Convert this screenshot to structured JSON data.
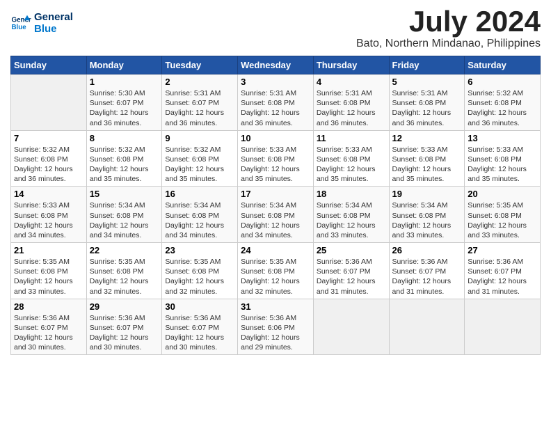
{
  "logo": {
    "line1": "General",
    "line2": "Blue"
  },
  "title": "July 2024",
  "location": "Bato, Northern Mindanao, Philippines",
  "days_of_week": [
    "Sunday",
    "Monday",
    "Tuesday",
    "Wednesday",
    "Thursday",
    "Friday",
    "Saturday"
  ],
  "weeks": [
    [
      {
        "day": "",
        "info": ""
      },
      {
        "day": "1",
        "info": "Sunrise: 5:30 AM\nSunset: 6:07 PM\nDaylight: 12 hours\nand 36 minutes."
      },
      {
        "day": "2",
        "info": "Sunrise: 5:31 AM\nSunset: 6:07 PM\nDaylight: 12 hours\nand 36 minutes."
      },
      {
        "day": "3",
        "info": "Sunrise: 5:31 AM\nSunset: 6:08 PM\nDaylight: 12 hours\nand 36 minutes."
      },
      {
        "day": "4",
        "info": "Sunrise: 5:31 AM\nSunset: 6:08 PM\nDaylight: 12 hours\nand 36 minutes."
      },
      {
        "day": "5",
        "info": "Sunrise: 5:31 AM\nSunset: 6:08 PM\nDaylight: 12 hours\nand 36 minutes."
      },
      {
        "day": "6",
        "info": "Sunrise: 5:32 AM\nSunset: 6:08 PM\nDaylight: 12 hours\nand 36 minutes."
      }
    ],
    [
      {
        "day": "7",
        "info": "Sunrise: 5:32 AM\nSunset: 6:08 PM\nDaylight: 12 hours\nand 36 minutes."
      },
      {
        "day": "8",
        "info": "Sunrise: 5:32 AM\nSunset: 6:08 PM\nDaylight: 12 hours\nand 35 minutes."
      },
      {
        "day": "9",
        "info": "Sunrise: 5:32 AM\nSunset: 6:08 PM\nDaylight: 12 hours\nand 35 minutes."
      },
      {
        "day": "10",
        "info": "Sunrise: 5:33 AM\nSunset: 6:08 PM\nDaylight: 12 hours\nand 35 minutes."
      },
      {
        "day": "11",
        "info": "Sunrise: 5:33 AM\nSunset: 6:08 PM\nDaylight: 12 hours\nand 35 minutes."
      },
      {
        "day": "12",
        "info": "Sunrise: 5:33 AM\nSunset: 6:08 PM\nDaylight: 12 hours\nand 35 minutes."
      },
      {
        "day": "13",
        "info": "Sunrise: 5:33 AM\nSunset: 6:08 PM\nDaylight: 12 hours\nand 35 minutes."
      }
    ],
    [
      {
        "day": "14",
        "info": "Sunrise: 5:33 AM\nSunset: 6:08 PM\nDaylight: 12 hours\nand 34 minutes."
      },
      {
        "day": "15",
        "info": "Sunrise: 5:34 AM\nSunset: 6:08 PM\nDaylight: 12 hours\nand 34 minutes."
      },
      {
        "day": "16",
        "info": "Sunrise: 5:34 AM\nSunset: 6:08 PM\nDaylight: 12 hours\nand 34 minutes."
      },
      {
        "day": "17",
        "info": "Sunrise: 5:34 AM\nSunset: 6:08 PM\nDaylight: 12 hours\nand 34 minutes."
      },
      {
        "day": "18",
        "info": "Sunrise: 5:34 AM\nSunset: 6:08 PM\nDaylight: 12 hours\nand 33 minutes."
      },
      {
        "day": "19",
        "info": "Sunrise: 5:34 AM\nSunset: 6:08 PM\nDaylight: 12 hours\nand 33 minutes."
      },
      {
        "day": "20",
        "info": "Sunrise: 5:35 AM\nSunset: 6:08 PM\nDaylight: 12 hours\nand 33 minutes."
      }
    ],
    [
      {
        "day": "21",
        "info": "Sunrise: 5:35 AM\nSunset: 6:08 PM\nDaylight: 12 hours\nand 33 minutes."
      },
      {
        "day": "22",
        "info": "Sunrise: 5:35 AM\nSunset: 6:08 PM\nDaylight: 12 hours\nand 32 minutes."
      },
      {
        "day": "23",
        "info": "Sunrise: 5:35 AM\nSunset: 6:08 PM\nDaylight: 12 hours\nand 32 minutes."
      },
      {
        "day": "24",
        "info": "Sunrise: 5:35 AM\nSunset: 6:08 PM\nDaylight: 12 hours\nand 32 minutes."
      },
      {
        "day": "25",
        "info": "Sunrise: 5:36 AM\nSunset: 6:07 PM\nDaylight: 12 hours\nand 31 minutes."
      },
      {
        "day": "26",
        "info": "Sunrise: 5:36 AM\nSunset: 6:07 PM\nDaylight: 12 hours\nand 31 minutes."
      },
      {
        "day": "27",
        "info": "Sunrise: 5:36 AM\nSunset: 6:07 PM\nDaylight: 12 hours\nand 31 minutes."
      }
    ],
    [
      {
        "day": "28",
        "info": "Sunrise: 5:36 AM\nSunset: 6:07 PM\nDaylight: 12 hours\nand 30 minutes."
      },
      {
        "day": "29",
        "info": "Sunrise: 5:36 AM\nSunset: 6:07 PM\nDaylight: 12 hours\nand 30 minutes."
      },
      {
        "day": "30",
        "info": "Sunrise: 5:36 AM\nSunset: 6:07 PM\nDaylight: 12 hours\nand 30 minutes."
      },
      {
        "day": "31",
        "info": "Sunrise: 5:36 AM\nSunset: 6:06 PM\nDaylight: 12 hours\nand 29 minutes."
      },
      {
        "day": "",
        "info": ""
      },
      {
        "day": "",
        "info": ""
      },
      {
        "day": "",
        "info": ""
      }
    ]
  ]
}
